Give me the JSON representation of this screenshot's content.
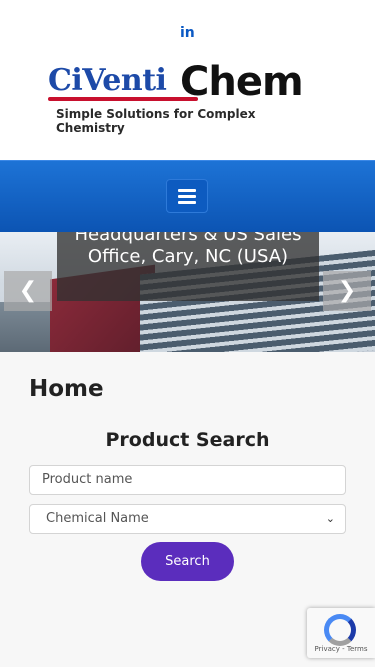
{
  "social": {
    "linkedin_label": "in"
  },
  "logo": {
    "part1": "CiVenti",
    "part2": "Chem",
    "tagline": "Simple Solutions for Complex Chemistry"
  },
  "nav": {
    "menu_icon": "hamburger-menu-icon"
  },
  "hero": {
    "caption": "Headquarters & US Sales Office, Cary, NC (USA)",
    "prev_icon": "chevron-left-icon",
    "next_icon": "chevron-right-icon"
  },
  "main": {
    "page_title": "Home",
    "search_title": "Product Search",
    "product_placeholder": "Product name",
    "select_value": "Chemical Name",
    "search_button": "Search"
  },
  "recaptcha": {
    "text": "Privacy - Terms"
  },
  "colors": {
    "nav": "#0c54b3",
    "button": "#5b2dbd",
    "link": "#0b59c4"
  }
}
